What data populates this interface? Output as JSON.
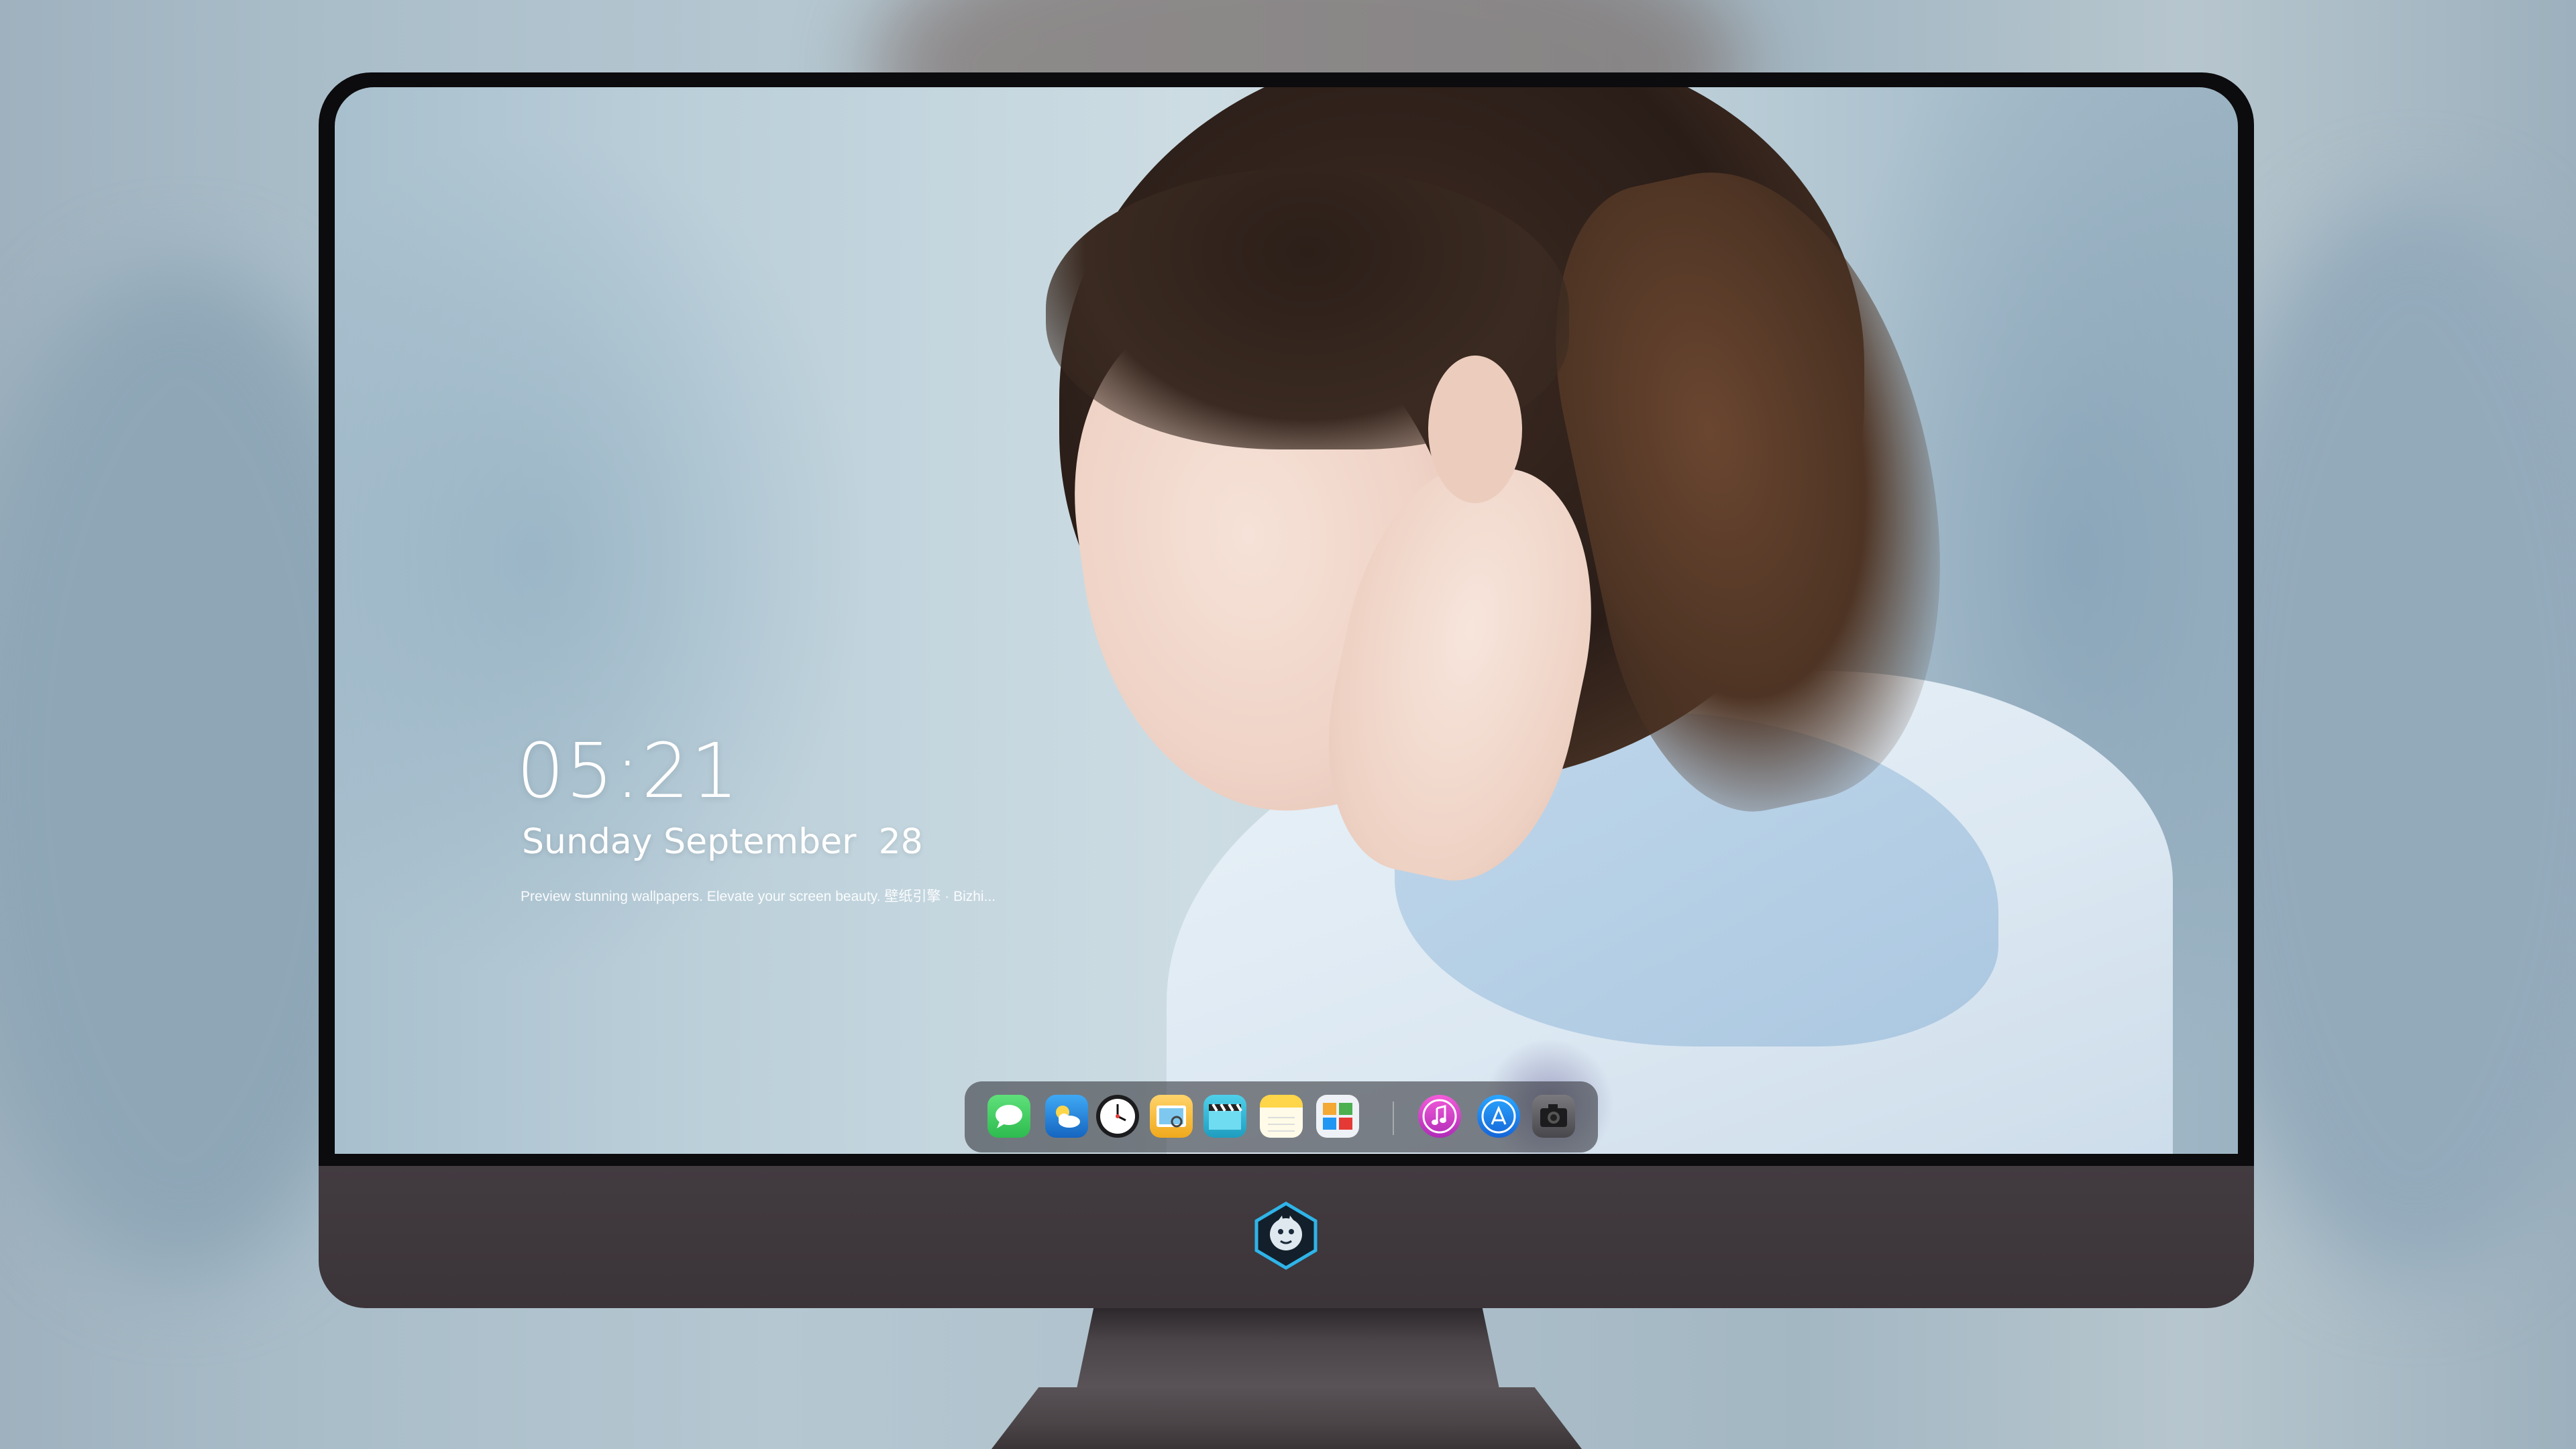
{
  "lock_screen": {
    "time": "05:21",
    "date": "Sunday September  28",
    "tagline": "Preview stunning wallpapers. Elevate your screen beauty. 壁纸引擎 · Bizhi..."
  },
  "dock": {
    "apps": [
      {
        "name": "messages-icon",
        "color": "#34c759"
      },
      {
        "name": "weather-icon",
        "color": "#1e88e5"
      },
      {
        "name": "clock-icon",
        "color": "#1c1c1e"
      },
      {
        "name": "preview-icon",
        "color": "#f5b93a"
      },
      {
        "name": "clapper-icon",
        "color": "#30b8d8"
      },
      {
        "name": "notes-icon",
        "color": "#fbd24c"
      },
      {
        "name": "photos-widget-icon",
        "color": "#eef2f6"
      },
      {
        "name": "music-icon",
        "color": "#d642c9"
      },
      {
        "name": "app-store-icon",
        "color": "#1e8cf2"
      },
      {
        "name": "camera-icon",
        "color": "#5c5c60"
      }
    ]
  },
  "monitor": {
    "bezel_color": "#0c0b0d",
    "chin_color": "#3f383c",
    "logo": "dragon-mascot-logo"
  }
}
